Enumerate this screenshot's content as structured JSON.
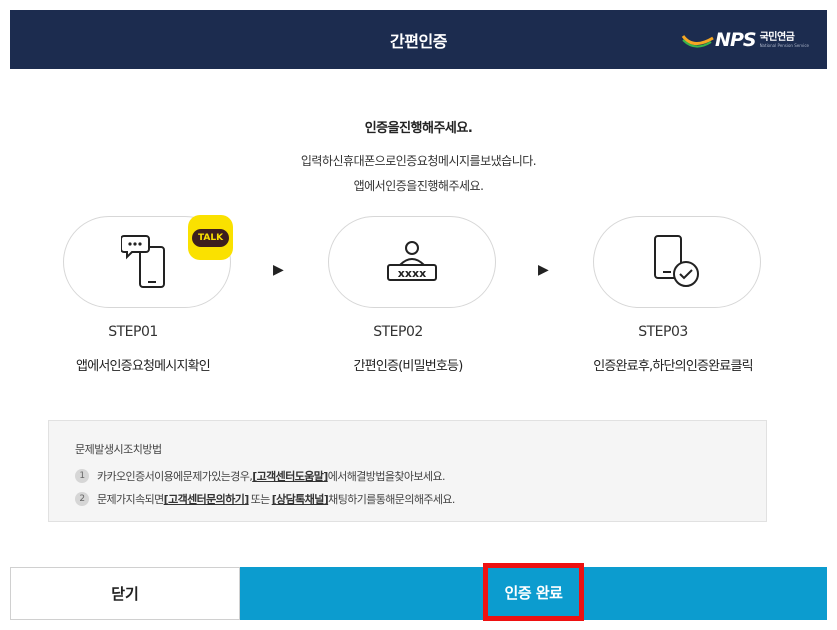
{
  "header": {
    "title": "간편인증",
    "logo_text": "NPS",
    "logo_korean": "국민연금",
    "logo_english": "National Pension Service"
  },
  "intro": {
    "title": "인증을진행해주세요.",
    "line1": "입력하신휴대폰으로인증요청메시지를보냈습니다.",
    "line2": "앱에서인증을진행해주세요."
  },
  "steps": [
    {
      "label": "STEP01",
      "desc": "앱에서인증요청메시지확인",
      "icon": "chat-phone-icon",
      "badge": "TALK"
    },
    {
      "label": "STEP02",
      "desc": "간편인증(비밀번호등)",
      "icon": "password-user-icon"
    },
    {
      "label": "STEP03",
      "desc": "인증완료후,하단의인증완료클릭",
      "icon": "phone-check-icon"
    }
  ],
  "arrow_symbol": "▶",
  "help": {
    "title": "문제발생시조치방법",
    "items": [
      {
        "num": "1",
        "before": "카카오인증서이용에문제가있는경우,",
        "link": "[고객센터도움말]",
        "after": "에서해결방법을찾아보세요."
      },
      {
        "num": "2",
        "before": "문제가지속되면",
        "link": "[고객센터문의하기]",
        "middle": "또는",
        "link2": "[상담톡채널]",
        "after": "채팅하기를통해문의해주세요."
      }
    ]
  },
  "buttons": {
    "close": "닫기",
    "done": "인증 완료"
  },
  "colors": {
    "header_bg": "#1c2c4f",
    "primary": "#0c9ccf",
    "highlight_border": "#ee1111",
    "kakao_yellow": "#fae100"
  }
}
